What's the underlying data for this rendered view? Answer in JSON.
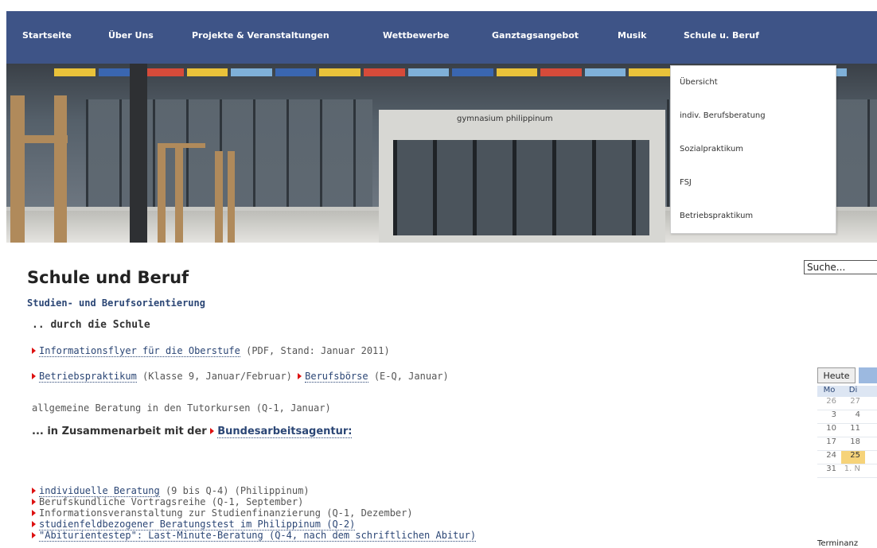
{
  "nav": {
    "items": [
      "Startseite",
      "Über Uns",
      "Projekte & Veranstaltungen",
      "Wettbewerbe",
      "Ganztagsangebot",
      "Musik",
      "Schule u. Beruf"
    ]
  },
  "banner": {
    "sign": "gymnasium  philippinum"
  },
  "dropdown": {
    "items": [
      "Übersicht",
      "indiv. Berufsberatung",
      "Sozialpraktikum",
      "FSJ",
      "Betriebspraktikum"
    ]
  },
  "content": {
    "title": "Schule und Beruf",
    "subtitle": "Studien- und Berufsorientierung",
    "subhead": ".. durch die Schule",
    "line1_link": "Informationsflyer für die Oberstufe",
    "line1_rest": " (PDF, Stand: Januar 2011)",
    "line2_link1": "Betriebspraktikum",
    "line2_mid": " (Klasse 9, Januar/Februar) ",
    "line2_link2": "Berufsbörse",
    "line2_rest": " (E-Q, Januar)",
    "line3": "allgemeine Beratung in den Tutorkursen (Q-1, Januar)",
    "heading2_text": "... in Zusammenarbeit mit der ",
    "heading2_link": "Bundesarbeitsagentur:",
    "list": [
      {
        "link": "individuelle Beratung",
        "rest": " (9 bis Q-4) (Philippinum)"
      },
      {
        "link": "",
        "rest": "Berufskundliche Vortragsreihe (Q-1, September)"
      },
      {
        "link": "",
        "rest": "Informationsveranstaltung zur Studienfinanzierung (Q-1, Dezember)"
      },
      {
        "link": "studienfeldbezogener Beratungstest im Philippinum (Q-2)",
        "rest": ""
      },
      {
        "link": "\"Abiturientestep\": Last-Minute-Beratung (Q-4, nach dem schriftlichen Abitur)",
        "rest": ""
      }
    ]
  },
  "sidebar": {
    "search_value": "Suche...",
    "today_label": "Heute",
    "cal_days": [
      "Mo",
      "Di"
    ],
    "cal_rows": [
      [
        "26",
        "27"
      ],
      [
        "3",
        "4"
      ],
      [
        "10",
        "11"
      ],
      [
        "17",
        "18"
      ],
      [
        "24",
        "25"
      ],
      [
        "31",
        "1. N"
      ]
    ],
    "terminanz": "Terminanz"
  }
}
